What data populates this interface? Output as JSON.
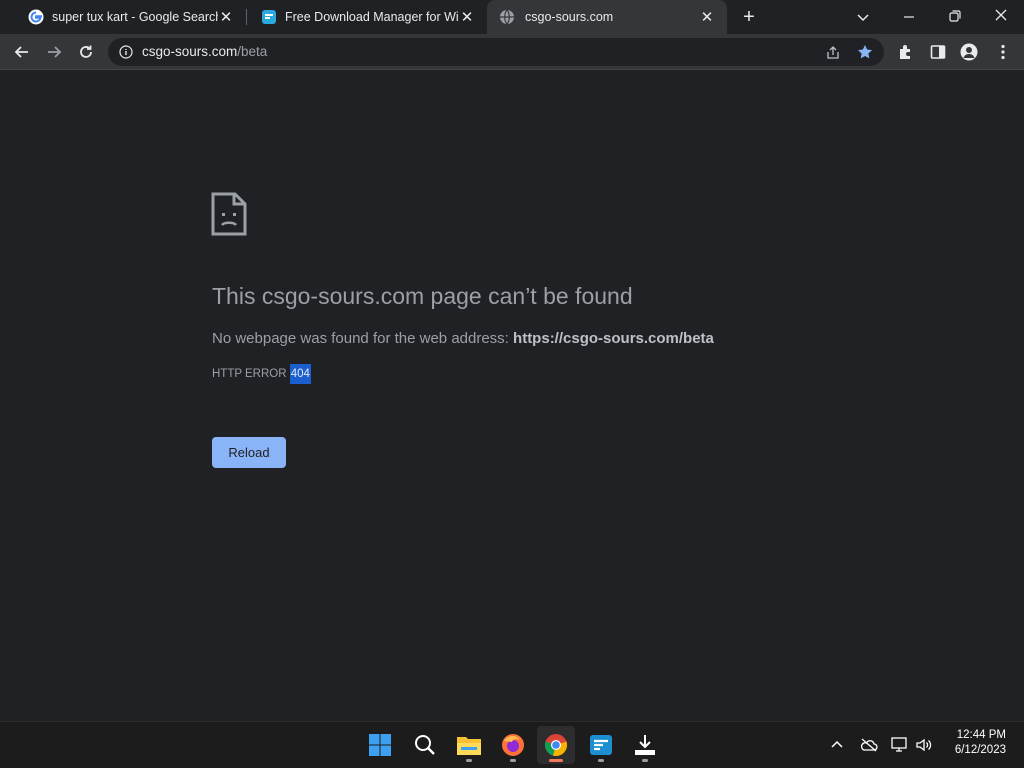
{
  "tabs": [
    {
      "title": "super tux kart - Google Search",
      "icon": "google-icon",
      "active": false
    },
    {
      "title": "Free Download Manager for Windows",
      "icon": "fdm-icon",
      "active": false
    },
    {
      "title": "csgo-sours.com",
      "icon": "globe-icon",
      "active": true
    }
  ],
  "address_bar": {
    "host": "csgo-sours.com",
    "path": "/beta"
  },
  "error_page": {
    "heading": "This csgo-sours.com page can’t be found",
    "description_prefix": "No webpage was found for the web address: ",
    "description_url": "https://csgo-sours.com/beta",
    "code_prefix": "HTTP ERROR ",
    "code_number": "404",
    "reload_label": "Reload"
  },
  "taskbar": {
    "apps": [
      "windows-start-icon",
      "search-icon",
      "file-explorer-icon",
      "firefox-icon",
      "chrome-icon",
      "fdm-taskbar-icon",
      "download-icon"
    ],
    "clock": {
      "time": "12:44 PM",
      "date": "6/12/2023"
    }
  },
  "colors": {
    "accent": "#8ab4f8",
    "selection": "#1a5fd0",
    "page_bg": "#202124",
    "toolbar_bg": "#35363a"
  }
}
